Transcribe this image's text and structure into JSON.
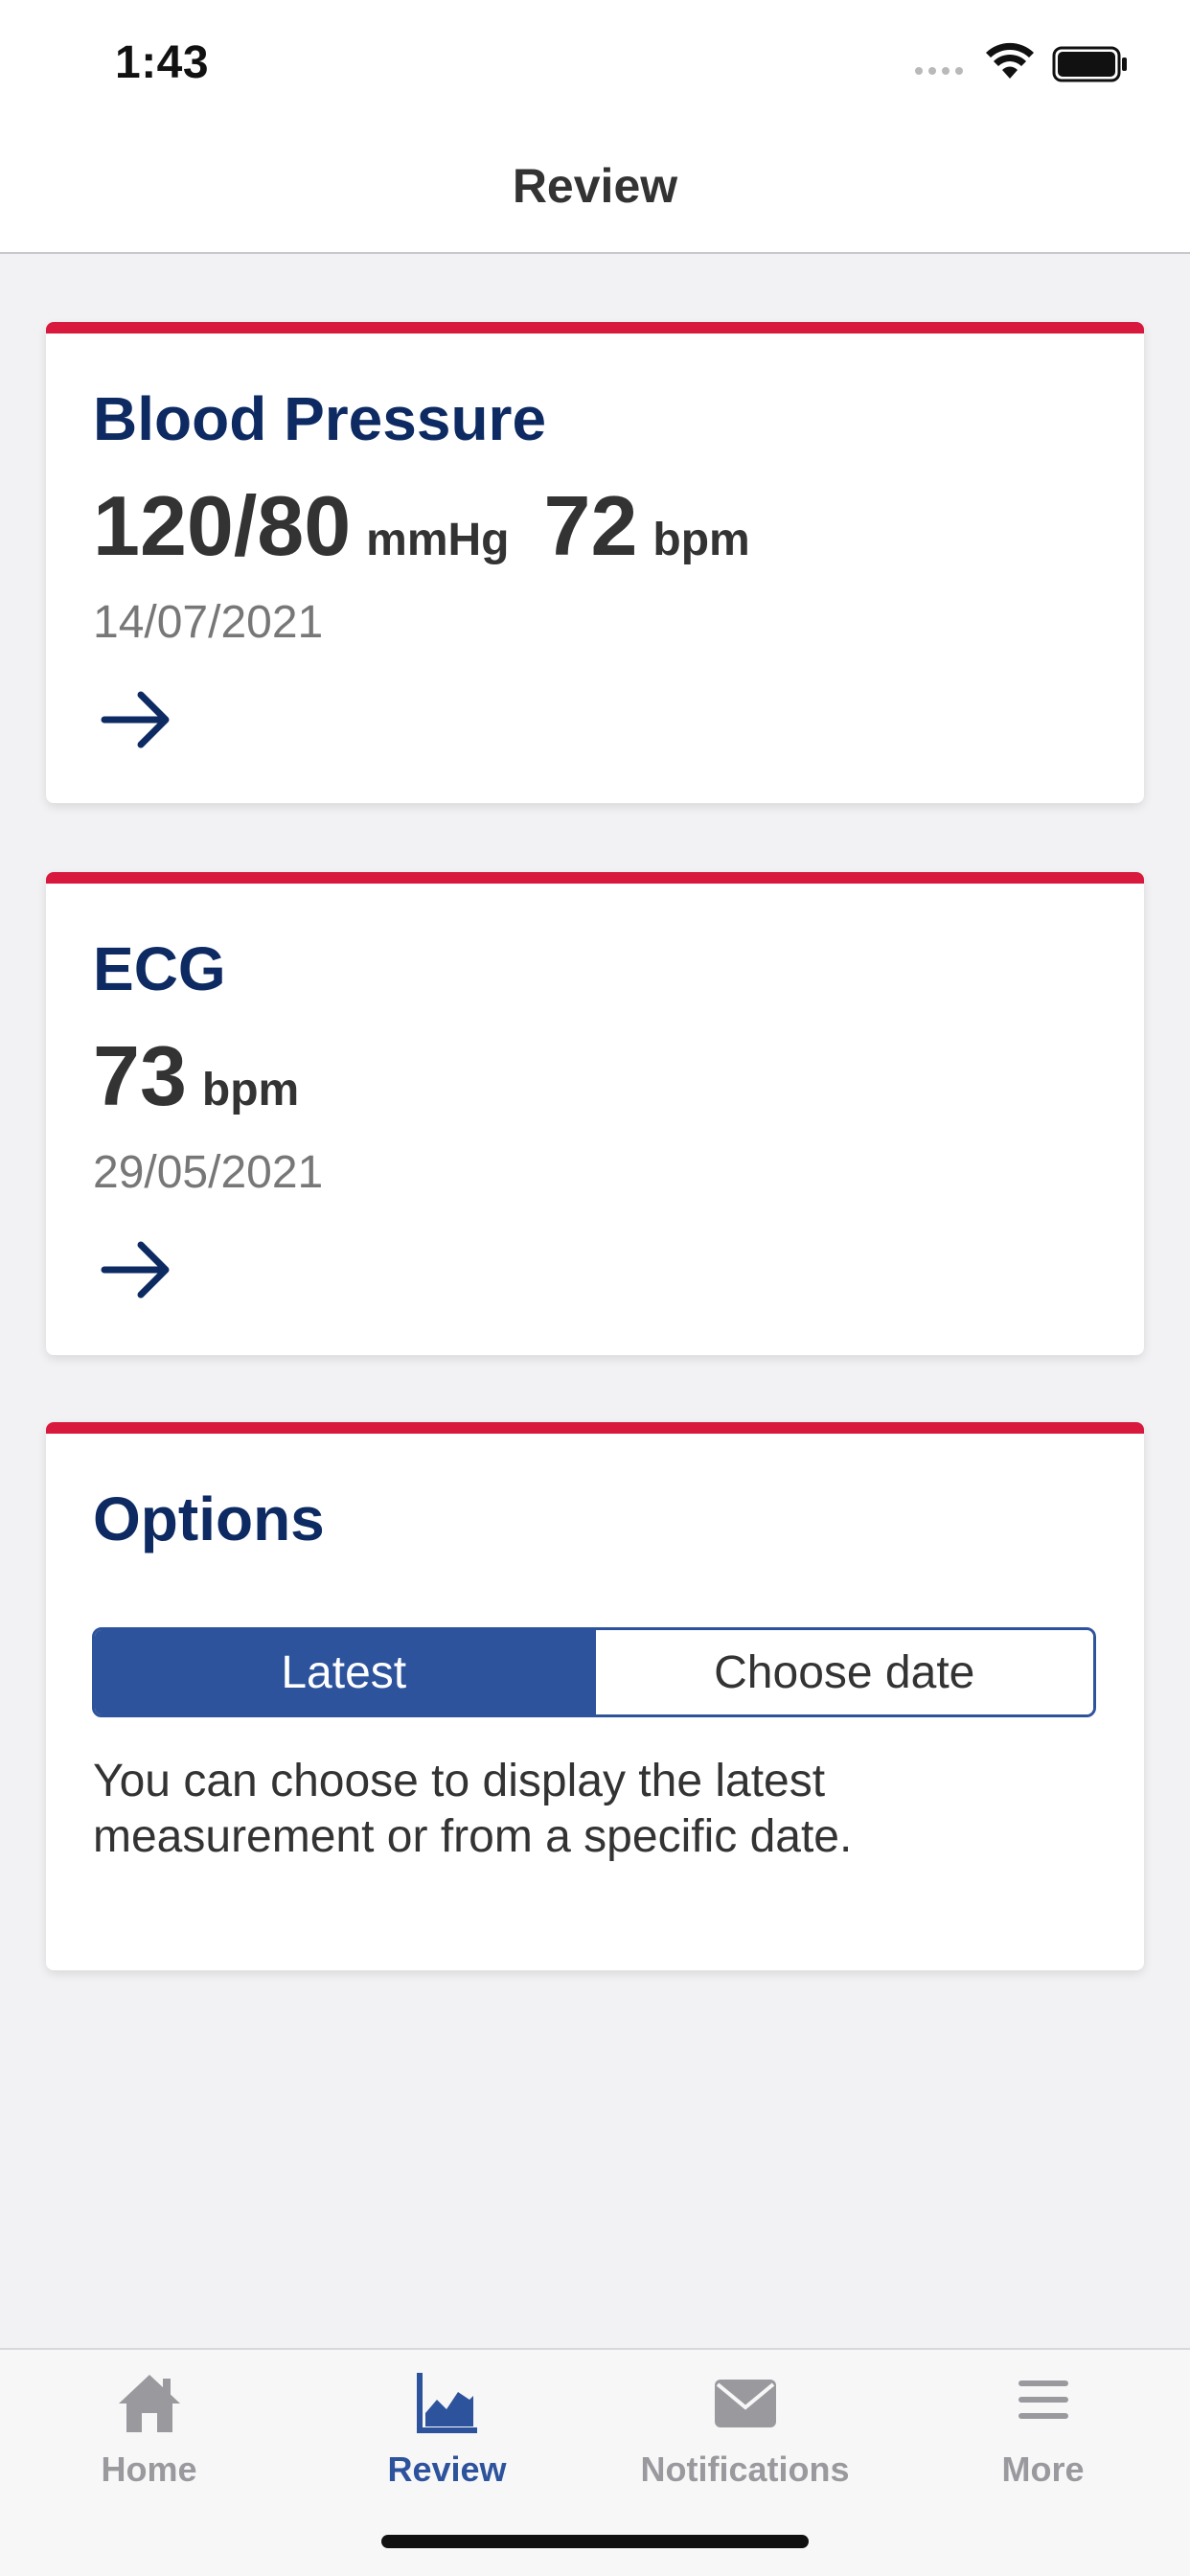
{
  "status_bar": {
    "time": "1:43"
  },
  "nav": {
    "title": "Review"
  },
  "blood_pressure": {
    "title": "Blood Pressure",
    "pressure_value": "120/80",
    "pressure_unit": "mmHg",
    "pulse_value": "72",
    "pulse_unit": "bpm",
    "date": "14/07/2021"
  },
  "ecg": {
    "title": "ECG",
    "pulse_value": "73",
    "pulse_unit": "bpm",
    "date": "29/05/2021"
  },
  "options": {
    "title": "Options",
    "segments": [
      {
        "label": "Latest",
        "selected": true
      },
      {
        "label": "Choose date",
        "selected": false
      }
    ],
    "description": "You can choose to display the latest measurement or from a specific date."
  },
  "tab_bar": {
    "tabs": [
      {
        "label": "Home",
        "icon": "home-icon",
        "active": false
      },
      {
        "label": "Review",
        "icon": "chart-icon",
        "active": true
      },
      {
        "label": "Notifications",
        "icon": "envelope-icon",
        "active": false
      },
      {
        "label": "More",
        "icon": "hamburger-menu-icon",
        "active": false
      }
    ]
  },
  "colors": {
    "accent_red": "#d8193d",
    "navy_title": "#0d2a62",
    "primary_blue": "#2d539c",
    "background": "#f2f2f4"
  }
}
